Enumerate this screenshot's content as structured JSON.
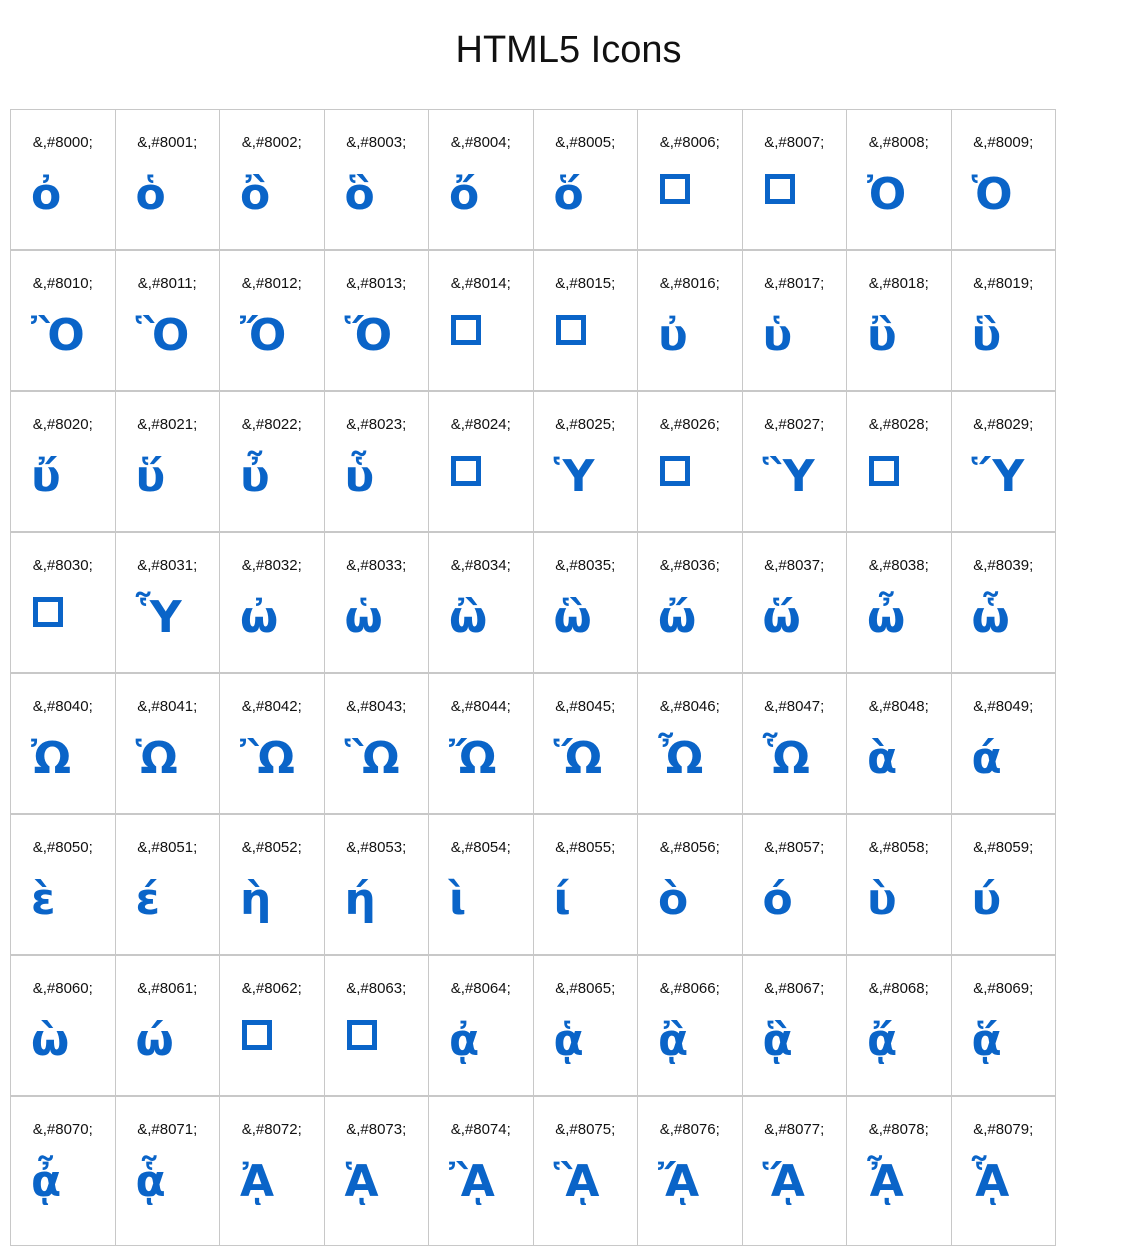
{
  "page": {
    "title": "HTML5 Icons"
  },
  "colors": {
    "glyph": "#0a64c8",
    "border": "#c8c8c8",
    "text": "#111111"
  },
  "cells": [
    {
      "code": "&,#8000;",
      "glyph": "ὀ"
    },
    {
      "code": "&,#8001;",
      "glyph": "ὁ"
    },
    {
      "code": "&,#8002;",
      "glyph": "ὂ"
    },
    {
      "code": "&,#8003;",
      "glyph": "ὃ"
    },
    {
      "code": "&,#8004;",
      "glyph": "ὄ"
    },
    {
      "code": "&,#8005;",
      "glyph": "ὅ"
    },
    {
      "code": "&,#8006;",
      "glyph": "",
      "box": true
    },
    {
      "code": "&,#8007;",
      "glyph": "",
      "box": true
    },
    {
      "code": "&,#8008;",
      "glyph": "Ὀ"
    },
    {
      "code": "&,#8009;",
      "glyph": "Ὁ"
    },
    {
      "code": "&,#8010;",
      "glyph": "Ὂ"
    },
    {
      "code": "&,#8011;",
      "glyph": "Ὃ"
    },
    {
      "code": "&,#8012;",
      "glyph": "Ὄ"
    },
    {
      "code": "&,#8013;",
      "glyph": "Ὅ"
    },
    {
      "code": "&,#8014;",
      "glyph": "",
      "box": true
    },
    {
      "code": "&,#8015;",
      "glyph": "",
      "box": true
    },
    {
      "code": "&,#8016;",
      "glyph": "ὐ"
    },
    {
      "code": "&,#8017;",
      "glyph": "ὑ"
    },
    {
      "code": "&,#8018;",
      "glyph": "ὒ"
    },
    {
      "code": "&,#8019;",
      "glyph": "ὓ"
    },
    {
      "code": "&,#8020;",
      "glyph": "ὔ"
    },
    {
      "code": "&,#8021;",
      "glyph": "ὕ"
    },
    {
      "code": "&,#8022;",
      "glyph": "ὖ"
    },
    {
      "code": "&,#8023;",
      "glyph": "ὗ"
    },
    {
      "code": "&,#8024;",
      "glyph": "",
      "box": true
    },
    {
      "code": "&,#8025;",
      "glyph": "Ὑ"
    },
    {
      "code": "&,#8026;",
      "glyph": "",
      "box": true
    },
    {
      "code": "&,#8027;",
      "glyph": "Ὓ"
    },
    {
      "code": "&,#8028;",
      "glyph": "",
      "box": true
    },
    {
      "code": "&,#8029;",
      "glyph": "Ὕ"
    },
    {
      "code": "&,#8030;",
      "glyph": "",
      "box": true
    },
    {
      "code": "&,#8031;",
      "glyph": "Ὗ"
    },
    {
      "code": "&,#8032;",
      "glyph": "ὠ"
    },
    {
      "code": "&,#8033;",
      "glyph": "ὡ"
    },
    {
      "code": "&,#8034;",
      "glyph": "ὢ"
    },
    {
      "code": "&,#8035;",
      "glyph": "ὣ"
    },
    {
      "code": "&,#8036;",
      "glyph": "ὤ"
    },
    {
      "code": "&,#8037;",
      "glyph": "ὥ"
    },
    {
      "code": "&,#8038;",
      "glyph": "ὦ"
    },
    {
      "code": "&,#8039;",
      "glyph": "ὧ"
    },
    {
      "code": "&,#8040;",
      "glyph": "Ὠ"
    },
    {
      "code": "&,#8041;",
      "glyph": "Ὡ"
    },
    {
      "code": "&,#8042;",
      "glyph": "Ὢ"
    },
    {
      "code": "&,#8043;",
      "glyph": "Ὣ"
    },
    {
      "code": "&,#8044;",
      "glyph": "Ὤ"
    },
    {
      "code": "&,#8045;",
      "glyph": "Ὥ"
    },
    {
      "code": "&,#8046;",
      "glyph": "Ὦ"
    },
    {
      "code": "&,#8047;",
      "glyph": "Ὧ"
    },
    {
      "code": "&,#8048;",
      "glyph": "ὰ"
    },
    {
      "code": "&,#8049;",
      "glyph": "ά"
    },
    {
      "code": "&,#8050;",
      "glyph": "ὲ"
    },
    {
      "code": "&,#8051;",
      "glyph": "έ"
    },
    {
      "code": "&,#8052;",
      "glyph": "ὴ"
    },
    {
      "code": "&,#8053;",
      "glyph": "ή"
    },
    {
      "code": "&,#8054;",
      "glyph": "ὶ"
    },
    {
      "code": "&,#8055;",
      "glyph": "ί"
    },
    {
      "code": "&,#8056;",
      "glyph": "ὸ"
    },
    {
      "code": "&,#8057;",
      "glyph": "ό"
    },
    {
      "code": "&,#8058;",
      "glyph": "ὺ"
    },
    {
      "code": "&,#8059;",
      "glyph": "ύ"
    },
    {
      "code": "&,#8060;",
      "glyph": "ὼ"
    },
    {
      "code": "&,#8061;",
      "glyph": "ώ"
    },
    {
      "code": "&,#8062;",
      "glyph": "",
      "box": true
    },
    {
      "code": "&,#8063;",
      "glyph": "",
      "box": true
    },
    {
      "code": "&,#8064;",
      "glyph": "ᾀ"
    },
    {
      "code": "&,#8065;",
      "glyph": "ᾁ"
    },
    {
      "code": "&,#8066;",
      "glyph": "ᾂ"
    },
    {
      "code": "&,#8067;",
      "glyph": "ᾃ"
    },
    {
      "code": "&,#8068;",
      "glyph": "ᾄ"
    },
    {
      "code": "&,#8069;",
      "glyph": "ᾅ"
    },
    {
      "code": "&,#8070;",
      "glyph": "ᾆ"
    },
    {
      "code": "&,#8071;",
      "glyph": "ᾇ"
    },
    {
      "code": "&,#8072;",
      "glyph": "ᾈ"
    },
    {
      "code": "&,#8073;",
      "glyph": "ᾉ"
    },
    {
      "code": "&,#8074;",
      "glyph": "ᾊ"
    },
    {
      "code": "&,#8075;",
      "glyph": "ᾋ"
    },
    {
      "code": "&,#8076;",
      "glyph": "ᾌ"
    },
    {
      "code": "&,#8077;",
      "glyph": "ᾍ"
    },
    {
      "code": "&,#8078;",
      "glyph": "ᾎ"
    },
    {
      "code": "&,#8079;",
      "glyph": "ᾏ"
    }
  ]
}
